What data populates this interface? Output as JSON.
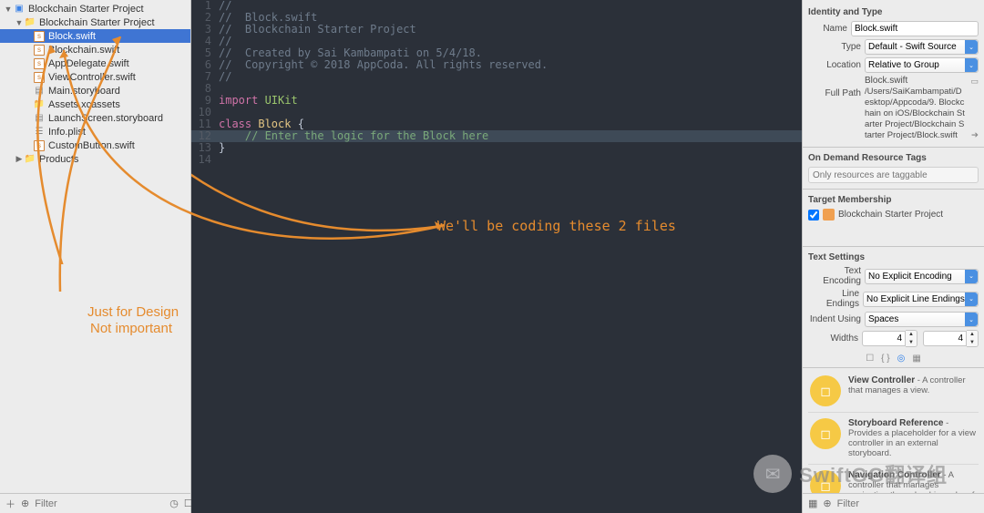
{
  "nav": {
    "root": "Blockchain Starter Project",
    "group": "Blockchain Starter Project",
    "files": [
      "Block.swift",
      "Blockchain.swift",
      "AppDelegate.swift",
      "ViewController.swift",
      "Main.storyboard",
      "Assets.xcassets",
      "LaunchScreen.storyboard",
      "Info.plist",
      "CustomButton.swift"
    ],
    "products": "Products",
    "filter_placeholder": "Filter"
  },
  "editor": {
    "lines": [
      {
        "n": 1,
        "cls": "c-comment",
        "t": "//"
      },
      {
        "n": 2,
        "cls": "c-comment",
        "t": "//  Block.swift"
      },
      {
        "n": 3,
        "cls": "c-comment",
        "t": "//  Blockchain Starter Project"
      },
      {
        "n": 4,
        "cls": "c-comment",
        "t": "//"
      },
      {
        "n": 5,
        "cls": "c-comment",
        "t": "//  Created by Sai Kambampati on 5/4/18."
      },
      {
        "n": 6,
        "cls": "c-comment",
        "t": "//  Copyright © 2018 AppCoda. All rights reserved."
      },
      {
        "n": 7,
        "cls": "c-comment",
        "t": "//"
      },
      {
        "n": 8,
        "cls": "",
        "t": ""
      },
      {
        "n": 9,
        "cls": "",
        "pre": "import ",
        "pre_cls": "c-key",
        "rest": "UIKit",
        "rest_cls": "c-import"
      },
      {
        "n": 10,
        "cls": "",
        "t": ""
      },
      {
        "n": 11,
        "cls": "",
        "pre": "class ",
        "pre_cls": "c-key",
        "mid": "Block",
        "mid_cls": "c-type",
        "rest": " {"
      },
      {
        "n": 12,
        "cls": "",
        "hl": true,
        "t": "    // Enter the logic for the Block here",
        "t_cls": "c-hl"
      },
      {
        "n": 13,
        "cls": "",
        "t": "}"
      },
      {
        "n": 14,
        "cls": "",
        "t": ""
      }
    ]
  },
  "inspector": {
    "identity_title": "Identity and Type",
    "name_lbl": "Name",
    "name_val": "Block.swift",
    "type_lbl": "Type",
    "type_val": "Default - Swift Source",
    "loc_lbl": "Location",
    "loc_val": "Relative to Group",
    "path_val": "Block.swift",
    "fullpath_lbl": "Full Path",
    "fullpath_val": "/Users/SaiKambampati/Desktop/Appcoda/9. Blockchain on iOS/Blockchain Starter Project/Blockchain Starter Project/Block.swift",
    "odr_title": "On Demand Resource Tags",
    "odr_placeholder": "Only resources are taggable",
    "tm_title": "Target Membership",
    "tm_item": "Blockchain Starter Project",
    "ts_title": "Text Settings",
    "te_lbl": "Text Encoding",
    "te_val": "No Explicit Encoding",
    "le_lbl": "Line Endings",
    "le_val": "No Explicit Line Endings",
    "iu_lbl": "Indent Using",
    "iu_val": "Spaces",
    "wid_lbl": "Widths",
    "wid_a": "4",
    "wid_b": "4",
    "lib": [
      {
        "title": "View Controller",
        "desc": " - A controller that manages a view."
      },
      {
        "title": "Storyboard Reference",
        "desc": " - Provides a placeholder for a view controller in an external storyboard."
      },
      {
        "title": "Navigation Controller",
        "desc": " - A controller that manages navigation through a hierarchy of views."
      }
    ],
    "filter_placeholder": "Filter"
  },
  "annotations": {
    "main": "We'll be coding these 2 files",
    "design1": "Just for Design",
    "design2": "Not important"
  },
  "watermark": "SwiftGG翻译组"
}
